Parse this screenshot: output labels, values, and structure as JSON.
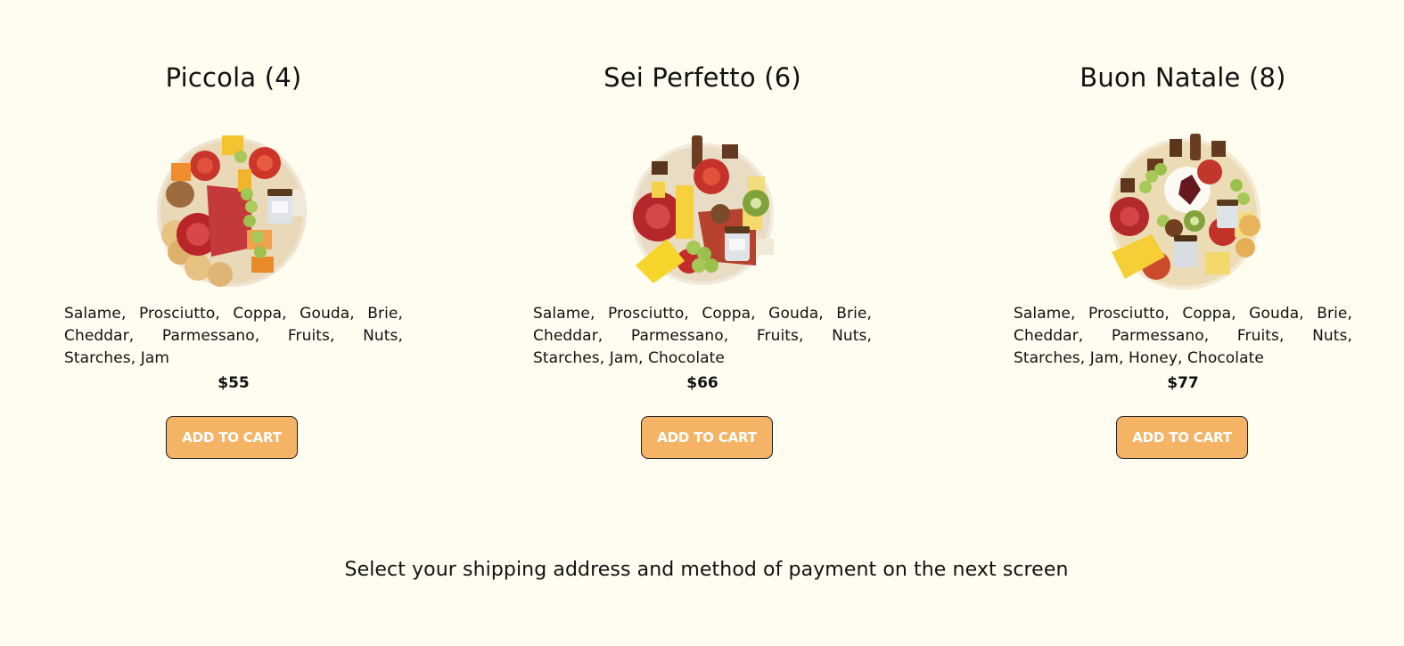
{
  "products": [
    {
      "title": "Piccola (4)",
      "image": "charcuterie-board-image",
      "description": "Salame, Prosciutto, Coppa, Gouda, Brie, Cheddar, Parmessano, Fruits, Nuts, Starches, Jam",
      "price": "$55",
      "button_label": "ADD TO CART"
    },
    {
      "title": "Sei Perfetto (6)",
      "image": "charcuterie-board-image",
      "description": "Salame, Prosciutto, Coppa, Gouda, Brie, Cheddar, Parmessano, Fruits, Nuts, Starches, Jam, Chocolate",
      "price": "$66",
      "button_label": "ADD TO CART"
    },
    {
      "title": "Buon Natale (8)",
      "image": "charcuterie-board-image",
      "description": "Salame, Prosciutto, Coppa, Gouda, Brie, Cheddar, Parmessano, Fruits, Nuts, Starches, Jam, Honey, Chocolate",
      "price": "$77",
      "button_label": "ADD TO CART"
    }
  ],
  "footer_note": "Select your shipping address and method of payment on the next screen",
  "colors": {
    "background": "#fffcf0",
    "button": "#f4b365",
    "button_text": "#ffffff",
    "text": "#111111"
  }
}
